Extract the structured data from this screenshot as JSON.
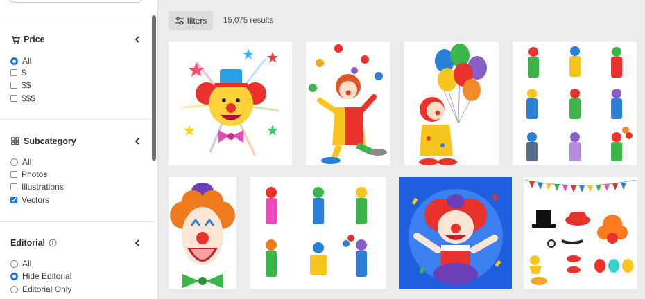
{
  "sidebar": {
    "price": {
      "title": "Price",
      "options": [
        "All",
        "$",
        "$$",
        "$$$"
      ],
      "selected": "All"
    },
    "subcategory": {
      "title": "Subcategory",
      "options": [
        "All",
        "Photos",
        "Illustrations",
        "Vectors"
      ],
      "checked": "Vectors"
    },
    "editorial": {
      "title": "Editorial",
      "options": [
        "All",
        "Hide Editorial",
        "Editorial Only"
      ],
      "selected": "Hide Editorial"
    }
  },
  "toolbar": {
    "filters_label": "filters",
    "results_count": "15,075 results"
  },
  "colors": {
    "accent": "#1473e6",
    "panel_bg": "#ffffff",
    "page_bg": "#ececec"
  }
}
